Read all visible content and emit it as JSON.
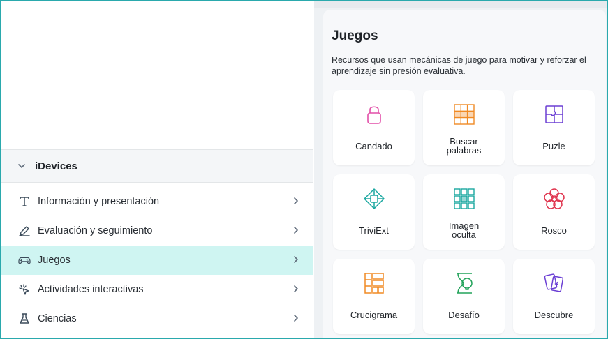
{
  "sidebar": {
    "section_title": "iDevices",
    "items": [
      {
        "label": "Información y presentación",
        "icon": "text-type-icon",
        "active": false
      },
      {
        "label": "Evaluación y seguimiento",
        "icon": "pen-icon",
        "active": false
      },
      {
        "label": "Juegos",
        "icon": "gamepad-icon",
        "active": true
      },
      {
        "label": "Actividades interactivas",
        "icon": "sparkle-pointer-icon",
        "active": false
      },
      {
        "label": "Ciencias",
        "icon": "flask-icon",
        "active": false
      }
    ]
  },
  "panel": {
    "title": "Juegos",
    "description": "Recursos que usan mecánicas de juego para motivar y reforzar el aprendizaje sin presión evaluativa.",
    "tiles": [
      {
        "label": "Candado",
        "icon": "padlock-icon",
        "color": "#e24fa8"
      },
      {
        "label": "Buscar\npalabras",
        "icon": "word-search-icon",
        "color": "#f08a24"
      },
      {
        "label": "Puzle",
        "icon": "puzzle-icon",
        "color": "#6b3fd4"
      },
      {
        "label": "TriviExt",
        "icon": "trivia-network-icon",
        "color": "#1aa7a0"
      },
      {
        "label": "Imagen\noculta",
        "icon": "hidden-image-grid-icon",
        "color": "#1aa7a0"
      },
      {
        "label": "Rosco",
        "icon": "flower-ring-icon",
        "color": "#e0364f"
      },
      {
        "label": "Crucigrama",
        "icon": "crossword-icon",
        "color": "#f08a24"
      },
      {
        "label": "Desafío",
        "icon": "hourglass-bulb-icon",
        "color": "#22a35a"
      },
      {
        "label": "Descubre",
        "icon": "cards-icon",
        "color": "#6b3fd4"
      }
    ]
  },
  "colors": {
    "accent_active_bg": "#cff5f2",
    "frame_border": "#2aa9ad"
  }
}
